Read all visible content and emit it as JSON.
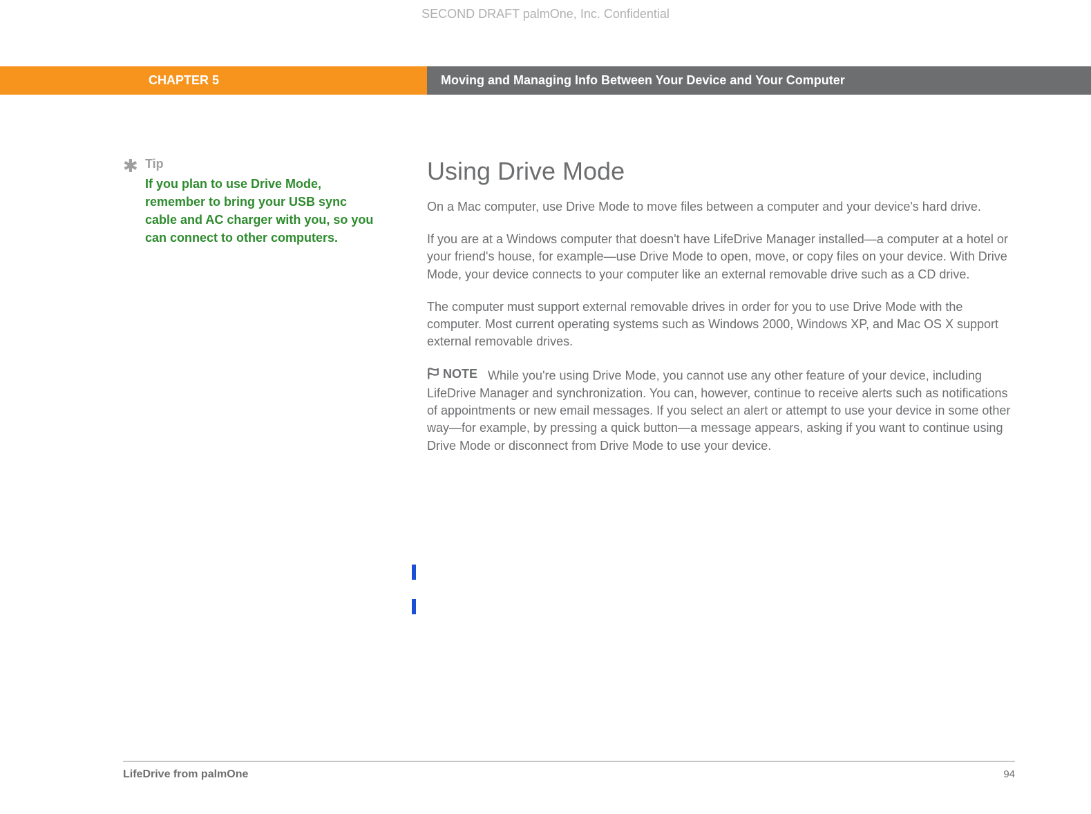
{
  "header": {
    "confidential": "SECOND DRAFT palmOne, Inc.  Confidential"
  },
  "chapter": {
    "label": "CHAPTER 5",
    "title": "Moving and Managing Info Between Your Device and Your Computer"
  },
  "tip": {
    "asterisk": "✱",
    "heading": "Tip",
    "body": "If you plan to use Drive Mode, remember to bring your USB sync cable and AC charger with you, so you can connect to other computers."
  },
  "main": {
    "section_title": "Using Drive Mode",
    "para1": "On a Mac computer, use Drive Mode to move files between a computer and your device's hard drive.",
    "para2": "If you are at a Windows computer that doesn't have LifeDrive Manager installed—a computer at a hotel or your friend's house, for example—use Drive Mode to open, move, or copy files on your device. With Drive Mode, your device connects to your computer like an external removable drive such as a CD drive.",
    "para3": "The computer must support external removable drives in order for you to use Drive Mode with the computer. Most current operating systems such as Windows 2000, Windows XP, and Mac OS X support external removable drives.",
    "note_label": "NOTE",
    "note_body": "While you're using Drive Mode, you cannot use any other feature of your device, including LifeDrive Manager and synchronization. You can, however, continue to receive alerts such as notifications of appointments or new email messages. If you select an alert or attempt to use your device in some other way—for example, by pressing a quick button—a message appears, asking if you want to continue using Drive Mode or disconnect from Drive Mode to use your device."
  },
  "footer": {
    "product": "LifeDrive from palmOne",
    "page": "94"
  }
}
